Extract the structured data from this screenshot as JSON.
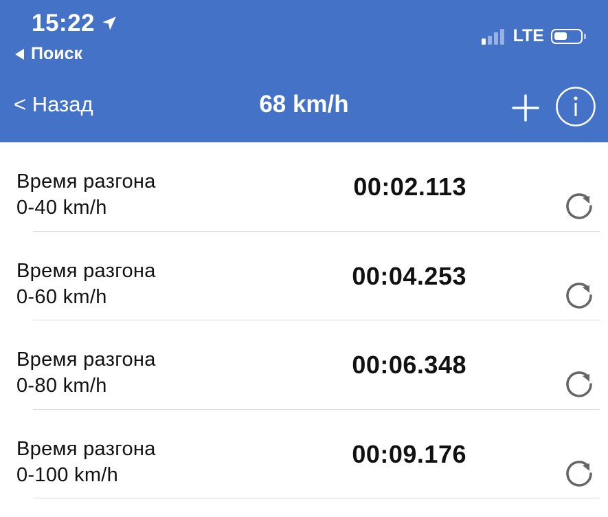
{
  "status_bar": {
    "time": "15:22",
    "location_icon": "location-arrow-icon",
    "back_app": "Поиск",
    "network": "LTE",
    "signal_bars_active": 1,
    "signal_bars_total": 4
  },
  "nav": {
    "back_label": "< Назад",
    "title": "68 km/h",
    "add_icon": "plus-icon",
    "info_icon": "info-icon"
  },
  "colors": {
    "header_bg": "#4472c7",
    "text": "#111111",
    "divider": "#d9d9d9",
    "icon_gray": "#666666"
  },
  "rows": [
    {
      "label": "Время разгона",
      "range": "0-40 km/h",
      "time": "00:02.113"
    },
    {
      "label": "Время разгона",
      "range": "0-60 km/h",
      "time": "00:04.253"
    },
    {
      "label": "Время разгона",
      "range": "0-80 km/h",
      "time": "00:06.348"
    },
    {
      "label": "Время разгона",
      "range": "0-100 km/h",
      "time": "00:09.176"
    }
  ]
}
